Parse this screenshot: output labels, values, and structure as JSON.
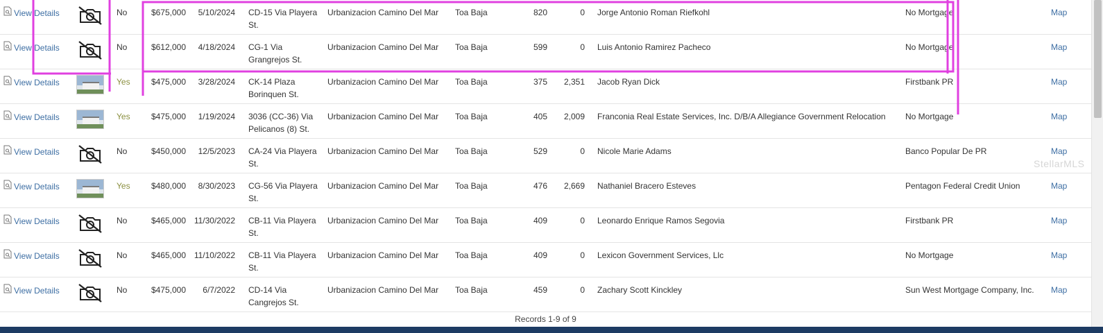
{
  "rows": [
    {
      "view_label": "View Details",
      "photo": "no-photo",
      "yn": "No",
      "price": "$675,000",
      "date": "5/10/2024",
      "address": "CD-15 Via Playera St.",
      "subdivision": "Urbanizacion Camino Del Mar",
      "city": "Toa Baja",
      "sqft": "820",
      "lot": "0",
      "buyer": "Jorge Antonio Roman Riefkohl",
      "lender": "No Mortgage",
      "map_label": "Map"
    },
    {
      "view_label": "View Details",
      "photo": "no-photo",
      "yn": "No",
      "price": "$612,000",
      "date": "4/18/2024",
      "address": "CG-1 Via Grangrejos St.",
      "subdivision": "Urbanizacion Camino Del Mar",
      "city": "Toa Baja",
      "sqft": "599",
      "lot": "0",
      "buyer": "Luis Antonio Ramirez Pacheco",
      "lender": "No Mortgage",
      "map_label": "Map"
    },
    {
      "view_label": "View Details",
      "photo": "photo",
      "yn": "Yes",
      "price": "$475,000",
      "date": "3/28/2024",
      "address": "CK-14 Plaza Borinquen St.",
      "subdivision": "Urbanizacion Camino Del Mar",
      "city": "Toa Baja",
      "sqft": "375",
      "lot": "2,351",
      "buyer": "Jacob Ryan Dick",
      "lender": "Firstbank PR",
      "map_label": "Map"
    },
    {
      "view_label": "View Details",
      "photo": "photo",
      "yn": "Yes",
      "price": "$475,000",
      "date": "1/19/2024",
      "address": "3036 (CC-36) Via Pelicanos (8) St.",
      "subdivision": "Urbanizacion Camino Del Mar",
      "city": "Toa Baja",
      "sqft": "405",
      "lot": "2,009",
      "buyer": "Franconia Real Estate Services, Inc. D/B/A Allegiance Government Relocation",
      "lender": "No Mortgage",
      "map_label": "Map"
    },
    {
      "view_label": "View Details",
      "photo": "no-photo",
      "yn": "No",
      "price": "$450,000",
      "date": "12/5/2023",
      "address": "CA-24 Via Playera St.",
      "subdivision": "Urbanizacion Camino Del Mar",
      "city": "Toa Baja",
      "sqft": "529",
      "lot": "0",
      "buyer": "Nicole Marie Adams",
      "lender": "Banco Popular De PR",
      "map_label": "Map"
    },
    {
      "view_label": "View Details",
      "photo": "photo",
      "yn": "Yes",
      "price": "$480,000",
      "date": "8/30/2023",
      "address": "CG-56 Via Playera St.",
      "subdivision": "Urbanizacion Camino Del Mar",
      "city": "Toa Baja",
      "sqft": "476",
      "lot": "2,669",
      "buyer": "Nathaniel Bracero Esteves",
      "lender": "Pentagon Federal Credit Union",
      "map_label": "Map"
    },
    {
      "view_label": "View Details",
      "photo": "no-photo",
      "yn": "No",
      "price": "$465,000",
      "date": "11/30/2022",
      "address": "CB-11 Via Playera St.",
      "subdivision": "Urbanizacion Camino Del Mar",
      "city": "Toa Baja",
      "sqft": "409",
      "lot": "0",
      "buyer": "Leonardo Enrique Ramos Segovia",
      "lender": "Firstbank PR",
      "map_label": "Map"
    },
    {
      "view_label": "View Details",
      "photo": "no-photo",
      "yn": "No",
      "price": "$465,000",
      "date": "11/10/2022",
      "address": "CB-11 Via Playera St.",
      "subdivision": "Urbanizacion Camino Del Mar",
      "city": "Toa Baja",
      "sqft": "409",
      "lot": "0",
      "buyer": "Lexicon Government Services, Llc",
      "lender": "No Mortgage",
      "map_label": "Map"
    },
    {
      "view_label": "View Details",
      "photo": "no-photo",
      "yn": "No",
      "price": "$475,000",
      "date": "6/7/2022",
      "address": "CD-14 Via Cangrejos St.",
      "subdivision": "Urbanizacion Camino Del Mar",
      "city": "Toa Baja",
      "sqft": "459",
      "lot": "0",
      "buyer": "Zachary Scott Kinckley",
      "lender": "Sun West Mortgage Company, Inc.",
      "map_label": "Map"
    }
  ],
  "footer": {
    "records_text": "Records 1-9 of 9"
  },
  "watermark": "StellarMLS",
  "colors": {
    "link": "#3d6ea3",
    "yes": "#8a8f3f",
    "annotation": "#e040e0",
    "bottom_bar": "#1d3b63"
  }
}
